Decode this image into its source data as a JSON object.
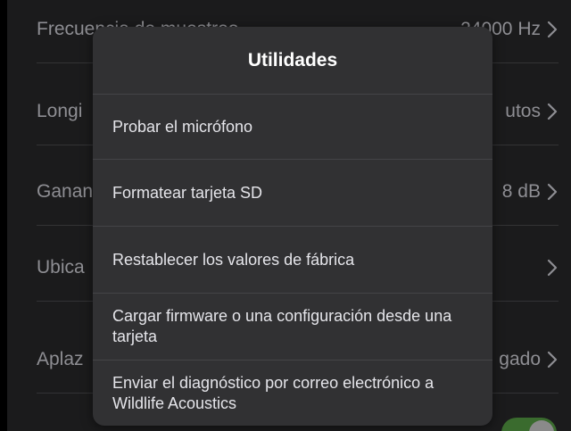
{
  "settings": {
    "rows": [
      {
        "label": "Frecuencia de muestreo",
        "value": "24000 Hz"
      },
      {
        "label": "Longi",
        "value": "utos"
      },
      {
        "label": "Ganan",
        "value": "8 dB"
      },
      {
        "label": "Ubica",
        "value": ""
      },
      {
        "label": "Aplaz",
        "value": "gado"
      }
    ],
    "toggle_on": true
  },
  "modal": {
    "title": "Utilidades",
    "items": [
      {
        "label": "Probar el micrófono"
      },
      {
        "label": "Formatear tarjeta SD"
      },
      {
        "label": "Restablecer los valores de fábrica"
      },
      {
        "label": "Cargar firmware o una configuración desde una tarjeta"
      },
      {
        "label": "Enviar el diagnóstico por correo electrónico a Wildlife Acoustics"
      }
    ]
  },
  "colors": {
    "modal_bg": "#313133",
    "toggle_on": "#3a6b2e",
    "text_dim": "#8e8e93"
  }
}
